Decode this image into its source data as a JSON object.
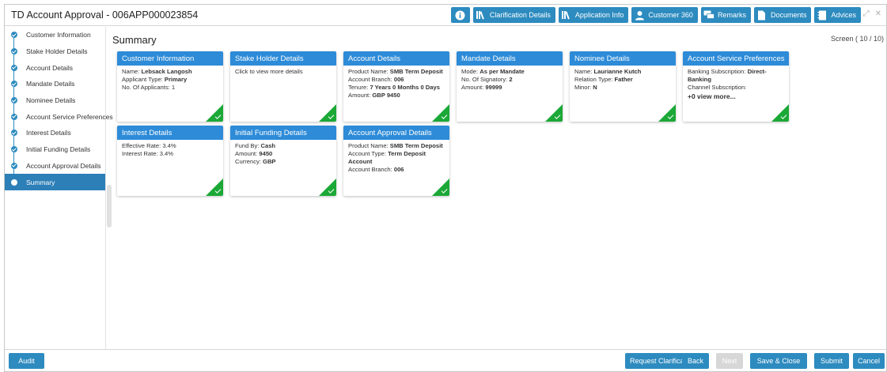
{
  "header": {
    "title": "TD Account Approval - 006APP000023854",
    "buttons": [
      "Clarification Details",
      "Application Info",
      "Customer 360",
      "Remarks",
      "Documents",
      "Advices"
    ],
    "window_controls": [
      "⤢",
      "✕"
    ]
  },
  "sidebar": {
    "items": [
      {
        "label": "Customer Information"
      },
      {
        "label": "Stake Holder Details"
      },
      {
        "label": "Account Details"
      },
      {
        "label": "Mandate Details"
      },
      {
        "label": "Nominee Details"
      },
      {
        "label": "Account Service Preferences"
      },
      {
        "label": "Interest Details"
      },
      {
        "label": "Initial Funding Details"
      },
      {
        "label": "Account Approval Details"
      },
      {
        "label": "Summary"
      }
    ]
  },
  "main": {
    "page_title": "Summary",
    "screen_no": "Screen ( 10 / 10)",
    "cards": [
      {
        "title": "Customer Information",
        "lines": [
          [
            "Name: ",
            "Lebsack Langosh"
          ],
          [
            "Applicant Type: ",
            "Primary"
          ],
          [
            "No. Of Applicants: 1",
            ""
          ]
        ]
      },
      {
        "title": "Stake Holder Details",
        "lines": [
          [
            "Click to view more details",
            ""
          ]
        ]
      },
      {
        "title": "Account Details",
        "lines": [
          [
            "Product Name: ",
            "SMB Term Deposit"
          ],
          [
            "Account Branch: ",
            "006"
          ],
          [
            "Tenure: ",
            "7 Years 0 Months 0 Days"
          ],
          [
            "Amount: ",
            "GBP 9450"
          ]
        ]
      },
      {
        "title": "Mandate Details",
        "lines": [
          [
            "Mode: ",
            "As per Mandate"
          ],
          [
            "No. Of Signatory: ",
            "2"
          ],
          [
            "Amount: ",
            "99999"
          ]
        ]
      },
      {
        "title": "Nominee Details",
        "lines": [
          [
            "Name: ",
            "Laurianne Kutch"
          ],
          [
            "Relation Type: ",
            "Father"
          ],
          [
            "Minor: ",
            "N"
          ]
        ]
      },
      {
        "title": "Account Service Preferences",
        "lines": [
          [
            "Banking Subscription: ",
            "Direct-Banking"
          ],
          [
            "Channel Subscription:",
            ""
          ],
          [
            "",
            "+0 view more..."
          ]
        ]
      },
      {
        "title": "Interest Details",
        "lines": [
          [
            "Effective Rate: 3.4%",
            ""
          ],
          [
            "Interest Rate: 3.4%",
            ""
          ]
        ]
      },
      {
        "title": "Initial Funding Details",
        "lines": [
          [
            "Fund By: ",
            "Cash"
          ],
          [
            "Amount: ",
            "9450"
          ],
          [
            "Currency: ",
            "GBP"
          ]
        ]
      },
      {
        "title": "Account Approval Details",
        "lines": [
          [
            "Product Name: ",
            "SMB Term Deposit"
          ],
          [
            "Account Type: ",
            "Term Deposit Account"
          ],
          [
            "Account Branch: ",
            "006"
          ]
        ]
      }
    ]
  },
  "footer": {
    "audit": "Audit",
    "request_clarification": "Request Clarification",
    "back": "Back",
    "next": "Next",
    "save_close": "Save & Close",
    "submit": "Submit",
    "cancel": "Cancel"
  },
  "colors": {
    "accent": "#2d8bbf",
    "card_header": "#2d8bd8",
    "success": "#1ba837",
    "active": "#2d7fb8"
  }
}
